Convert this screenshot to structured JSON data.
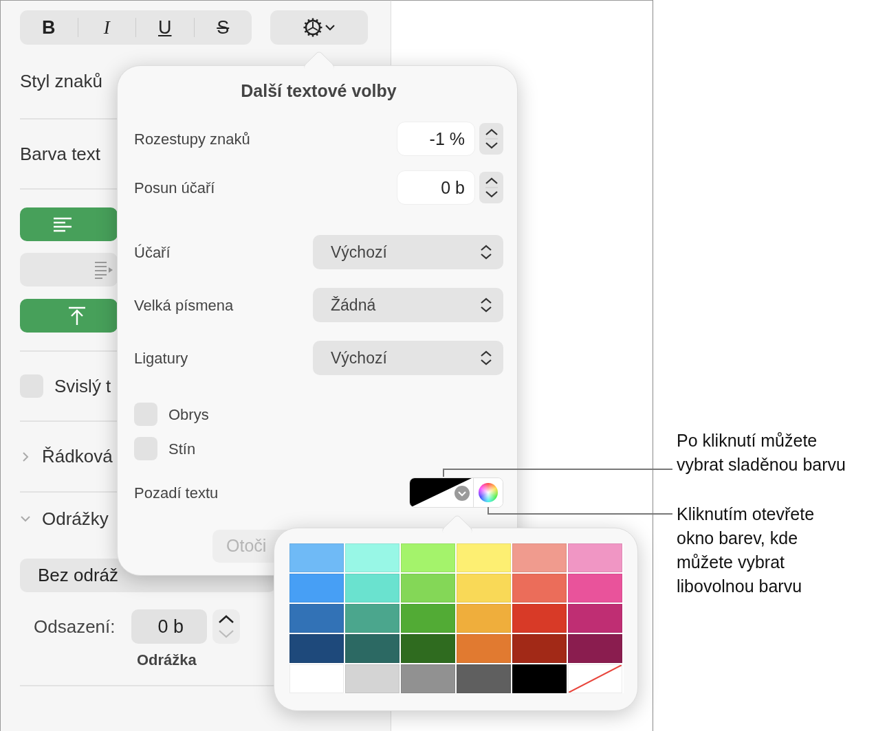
{
  "sidebar": {
    "format_buttons": [
      {
        "kind": "bold",
        "label": "B"
      },
      {
        "kind": "italic",
        "label": "I"
      },
      {
        "kind": "underline",
        "label": "U"
      },
      {
        "kind": "strike",
        "label": "S"
      }
    ],
    "character_style_label": "Styl znaků",
    "text_color_label": "Barva text",
    "alignment_rows": [
      {
        "kind": "align-left",
        "selected": true
      },
      {
        "kind": "indent",
        "selected": false
      },
      {
        "kind": "align-top",
        "selected": true
      }
    ],
    "vertical_text": {
      "label": "Svislý t",
      "checked": false
    },
    "sections": [
      {
        "label": "Řádková",
        "expanded": false
      },
      {
        "label": "Odrážky",
        "expanded": true
      }
    ],
    "bullet_style": "Bez odráž",
    "indent": {
      "label": "Odsazení:",
      "value": "0 b",
      "caption": "Odrážka"
    }
  },
  "text_options": {
    "title": "Další textové volby",
    "fields": [
      {
        "label": "Rozestupy znaků",
        "value": "-1 %"
      },
      {
        "label": "Posun účaří",
        "value": "0 b"
      }
    ],
    "selects": [
      {
        "label": "Účaří",
        "value": "Výchozí"
      },
      {
        "label": "Velká písmena",
        "value": "Žádná"
      },
      {
        "label": "Ligatury",
        "value": "Výchozí"
      }
    ],
    "checkboxes": [
      {
        "label": "Obrys",
        "checked": false
      },
      {
        "label": "Stín",
        "checked": false
      }
    ],
    "background_label": "Pozadí textu",
    "rotate_button": {
      "label": "Otoči",
      "disabled": true
    }
  },
  "color_palette": {
    "swatches": [
      {
        "kind": "color",
        "color": "#6fbaf6"
      },
      {
        "kind": "color",
        "color": "#98f7e6"
      },
      {
        "kind": "color",
        "color": "#a4f36b"
      },
      {
        "kind": "color",
        "color": "#fdef72"
      },
      {
        "kind": "color",
        "color": "#f09b8e"
      },
      {
        "kind": "color",
        "color": "#f096c4"
      },
      {
        "kind": "color",
        "color": "#479ff5"
      },
      {
        "kind": "color",
        "color": "#6ae2cf"
      },
      {
        "kind": "color",
        "color": "#84d757"
      },
      {
        "kind": "color",
        "color": "#f9d957"
      },
      {
        "kind": "color",
        "color": "#eb6d5a"
      },
      {
        "kind": "color",
        "color": "#e9539b"
      },
      {
        "kind": "color",
        "color": "#3272b6"
      },
      {
        "kind": "color",
        "color": "#4ba68d"
      },
      {
        "kind": "color",
        "color": "#52ab35"
      },
      {
        "kind": "color",
        "color": "#efae3c"
      },
      {
        "kind": "color",
        "color": "#d83a27"
      },
      {
        "kind": "color",
        "color": "#bf2e73"
      },
      {
        "kind": "color",
        "color": "#1e497b"
      },
      {
        "kind": "color",
        "color": "#2c6963"
      },
      {
        "kind": "color",
        "color": "#2f6b1f"
      },
      {
        "kind": "color",
        "color": "#e17a30"
      },
      {
        "kind": "color",
        "color": "#a22917"
      },
      {
        "kind": "color",
        "color": "#8a1d4f"
      },
      {
        "kind": "color",
        "color": "#ffffff"
      },
      {
        "kind": "color",
        "color": "#d4d4d4"
      },
      {
        "kind": "color",
        "color": "#919191"
      },
      {
        "kind": "color",
        "color": "#5f5f5f"
      },
      {
        "kind": "color",
        "color": "#000000"
      },
      {
        "kind": "none"
      }
    ]
  },
  "callouts": [
    {
      "text": "Po kliknutí můžete\nvybrat sladěnou barvu"
    },
    {
      "text": "Kliknutím otevřete\nokno barev, kde\nmůžete vybrat\nlibovolnou barvu"
    }
  ]
}
